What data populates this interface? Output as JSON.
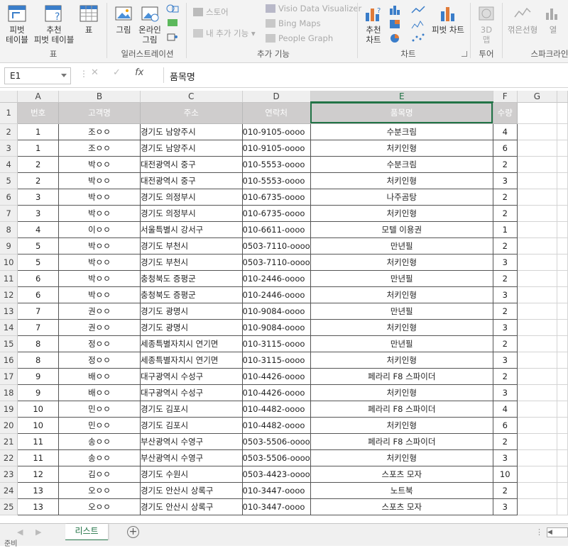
{
  "ribbon": {
    "groups": {
      "table": "표",
      "illustrations": "일러스트레이션",
      "addins": "추가 기능",
      "charts": "차트",
      "tours": "투어",
      "sparklines": "스파크라인"
    },
    "buttons": {
      "pivot_table_l1": "피벗",
      "pivot_table_l2": "테이블",
      "recommended_pivot_l1": "추천",
      "recommended_pivot_l2": "피벗 테이블",
      "table": "표",
      "pictures": "그림",
      "online_pictures_l1": "온라인",
      "online_pictures_l2": "그림",
      "store": "스토어",
      "my_addins": "내 추가 기능",
      "visio": "Visio Data Visualizer",
      "bing_maps": "Bing Maps",
      "people_graph": "People Graph",
      "recommended_charts_l1": "추천",
      "recommended_charts_l2": "차트",
      "pivot_chart": "피벗 차트",
      "map3d_l1": "3D",
      "map3d_l2": "맵",
      "line_sparkline": "꺾은선형",
      "column_sparkline": "열"
    }
  },
  "formula_bar": {
    "name_box": "E1",
    "formula": "품목명",
    "fx": "fx"
  },
  "sheet": {
    "columns": [
      "A",
      "B",
      "C",
      "D",
      "E",
      "F",
      "G"
    ],
    "headers": [
      "번호",
      "고객명",
      "주소",
      "연락처",
      "품목명",
      "수량"
    ],
    "rows": [
      [
        "1",
        "조ㅇㅇ",
        "경기도 남양주시",
        "010-9105-oooo",
        "수분크림",
        "4"
      ],
      [
        "1",
        "조ㅇㅇ",
        "경기도 남양주시",
        "010-9105-oooo",
        "처키인형",
        "6"
      ],
      [
        "2",
        "박ㅇㅇ",
        "대전광역시 중구",
        "010-5553-oooo",
        "수분크림",
        "2"
      ],
      [
        "2",
        "박ㅇㅇ",
        "대전광역시 중구",
        "010-5553-oooo",
        "처키인형",
        "3"
      ],
      [
        "3",
        "박ㅇㅇ",
        "경기도 의정부시",
        "010-6735-oooo",
        "나주곰탕",
        "2"
      ],
      [
        "3",
        "박ㅇㅇ",
        "경기도 의정부시",
        "010-6735-oooo",
        "처키인형",
        "2"
      ],
      [
        "4",
        "이ㅇㅇ",
        "서울특별시 강서구",
        "010-6611-oooo",
        "모텔 이용권",
        "1"
      ],
      [
        "5",
        "박ㅇㅇ",
        "경기도 부천시",
        "0503-7110-oooo",
        "만년필",
        "2"
      ],
      [
        "5",
        "박ㅇㅇ",
        "경기도 부천시",
        "0503-7110-oooo",
        "처키인형",
        "3"
      ],
      [
        "6",
        "박ㅇㅇ",
        "충청북도 증평군",
        "010-2446-oooo",
        "만년필",
        "2"
      ],
      [
        "6",
        "박ㅇㅇ",
        "충청북도 증평군",
        "010-2446-oooo",
        "처키인형",
        "3"
      ],
      [
        "7",
        "권ㅇㅇ",
        "경기도 광명시",
        "010-9084-oooo",
        "만년필",
        "2"
      ],
      [
        "7",
        "권ㅇㅇ",
        "경기도 광명시",
        "010-9084-oooo",
        "처키인형",
        "3"
      ],
      [
        "8",
        "정ㅇㅇ",
        "세종특별자치시 연기면",
        "010-3115-oooo",
        "만년필",
        "2"
      ],
      [
        "8",
        "정ㅇㅇ",
        "세종특별자치시 연기면",
        "010-3115-oooo",
        "처키인형",
        "3"
      ],
      [
        "9",
        "배ㅇㅇ",
        "대구광역시 수성구",
        "010-4426-oooo",
        "페라리 F8 스파이더",
        "2"
      ],
      [
        "9",
        "배ㅇㅇ",
        "대구광역시 수성구",
        "010-4426-oooo",
        "처키인형",
        "3"
      ],
      [
        "10",
        "민ㅇㅇ",
        "경기도 김포시",
        "010-4482-oooo",
        "페라리 F8 스파이더",
        "4"
      ],
      [
        "10",
        "민ㅇㅇ",
        "경기도 김포시",
        "010-4482-oooo",
        "처키인형",
        "6"
      ],
      [
        "11",
        "송ㅇㅇ",
        "부산광역시 수영구",
        "0503-5506-oooo",
        "페라리 F8 스파이더",
        "2"
      ],
      [
        "11",
        "송ㅇㅇ",
        "부산광역시 수영구",
        "0503-5506-oooo",
        "처키인형",
        "3"
      ],
      [
        "12",
        "김ㅇㅇ",
        "경기도 수원시",
        "0503-4423-oooo",
        "스포츠 모자",
        "10"
      ],
      [
        "13",
        "오ㅇㅇ",
        "경기도 안산시 상록구",
        "010-3447-oooo",
        "노트북",
        "2"
      ],
      [
        "13",
        "오ㅇㅇ",
        "경기도 안산시 상록구",
        "010-3447-oooo",
        "스포츠 모자",
        "3"
      ]
    ]
  },
  "tabs": {
    "active_sheet": "리스트",
    "add": "+"
  },
  "status": {
    "text": "준비"
  },
  "colors": {
    "accent": "#217346",
    "header_fill": "#cfcdcd"
  }
}
